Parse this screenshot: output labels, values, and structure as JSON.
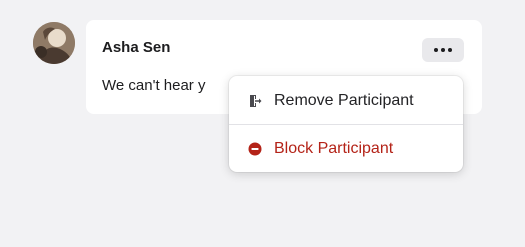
{
  "comment": {
    "author": "Asha Sen",
    "text": "We can't hear y",
    "avatar_icon": "user-photo"
  },
  "more_button": {
    "icon": "ellipsis-icon"
  },
  "menu": {
    "items": [
      {
        "label": "Remove Participant",
        "icon": "leave-door-icon",
        "color": "#232326"
      },
      {
        "label": "Block Participant",
        "icon": "minus-circle-icon",
        "color": "#b42318"
      }
    ]
  }
}
